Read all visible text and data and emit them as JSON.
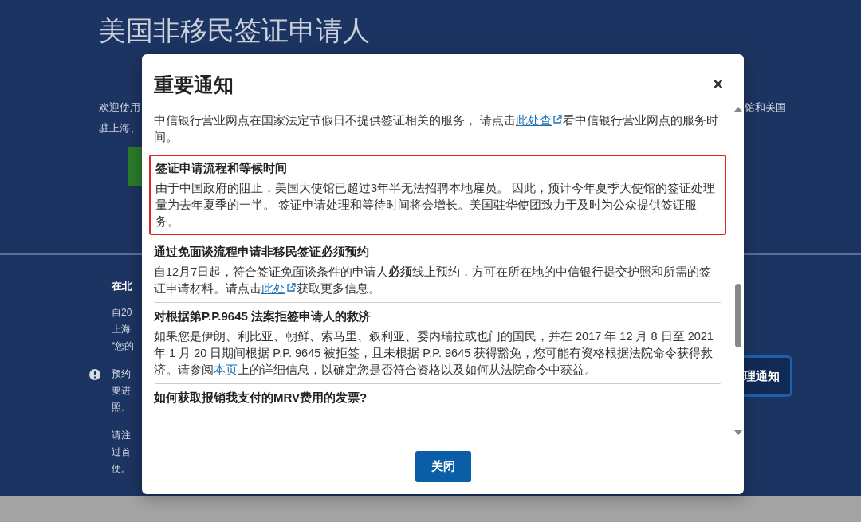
{
  "page": {
    "title": "美国非移民签证申请人",
    "left_fragments": [
      "欢迎使用",
      "驻上海、"
    ],
    "right_fragments": [
      "馆和美国"
    ],
    "lower_heading": "在北",
    "lower_groups": [
      {
        "info": false,
        "lines": [
          "自20",
          "上海",
          "“您的"
        ]
      },
      {
        "info": true,
        "lines": [
          "预约",
          "要进",
          "照。"
        ]
      },
      {
        "info": false,
        "lines": [
          "请注",
          "过首",
          "便。"
        ]
      }
    ],
    "lower_button": "理通知"
  },
  "dialog": {
    "title": "重要通知",
    "close": "×",
    "notices": [
      {
        "highlighted": false,
        "body": [
          {
            "kind": "text",
            "text": "中信银行营业网点在国家法定节假日不提供签证相关的服务， 请点击"
          },
          {
            "kind": "link",
            "text": "此处查",
            "external": true
          },
          {
            "kind": "text",
            "text": "看中信银行营业网点的服务时间。"
          }
        ]
      },
      {
        "highlighted": true,
        "title": "签证申请流程和等候时间",
        "body": [
          {
            "kind": "text",
            "text": "由于中国政府的阻止，美国大使馆已超过3年半无法招聘本地雇员。 因此，预计今年夏季大使馆的签证处理量为去年夏季的一半。 签证申请处理和等待时间将会增长。美国驻华使团致力于及时为公众提供签证服务。"
          }
        ]
      },
      {
        "highlighted": false,
        "title": "通过免面谈流程申请非移民签证必须预约",
        "body": [
          {
            "kind": "text",
            "text": "自12月7日起，符合签证免面谈条件的申请人"
          },
          {
            "kind": "strong",
            "text": "必须"
          },
          {
            "kind": "text",
            "text": "线上预约，方可在所在地的中信银行提交护照和所需的签证申请材料。请点击"
          },
          {
            "kind": "link",
            "text": "此处",
            "external": true
          },
          {
            "kind": "text",
            "text": "获取更多信息。"
          }
        ]
      },
      {
        "highlighted": false,
        "title": "对根据第P.P.9645 法案拒签申请人的救济",
        "body": [
          {
            "kind": "text",
            "text": "如果您是伊朗、利比亚、朝鲜、索马里、叙利亚、委内瑞拉或也门的国民，并在 2017 年 12 月 8 日至 2021 年 1 月 20 日期间根据 P.P. 9645 被拒签，且未根据 P.P. 9645 获得豁免，您可能有资格根据法院命令获得救济。请参阅"
          },
          {
            "kind": "link",
            "text": "本页",
            "external": false
          },
          {
            "kind": "text",
            "text": "上的详细信息，以确定您是否符合资格以及如何从法院命令中获益。"
          }
        ]
      },
      {
        "highlighted": false,
        "title": "如何获取报销我支付的MRV费用的发票?"
      }
    ],
    "button": "关闭"
  }
}
